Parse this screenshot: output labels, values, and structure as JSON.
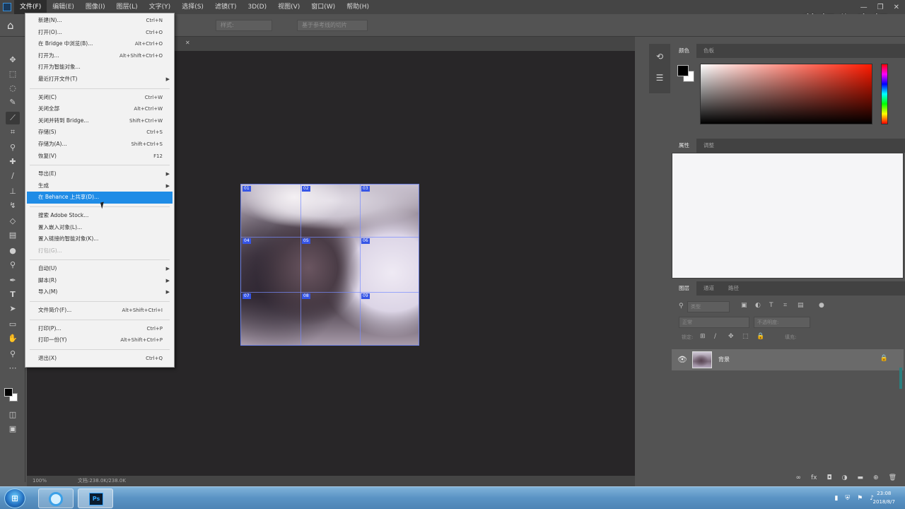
{
  "menubar": {
    "items": [
      "文件(F)",
      "编辑(E)",
      "图像(I)",
      "图层(L)",
      "文字(Y)",
      "选择(S)",
      "滤镜(T)",
      "3D(D)",
      "视图(V)",
      "窗口(W)",
      "帮助(H)"
    ],
    "active_index": 0
  },
  "watermark": "花好你也好",
  "options": {
    "field1": "样式:",
    "field2": "基于参考线的切片"
  },
  "file_menu": {
    "items": [
      {
        "label": "新建(N)...",
        "shortcut": "Ctrl+N"
      },
      {
        "label": "打开(O)...",
        "shortcut": "Ctrl+O"
      },
      {
        "label": "在 Bridge 中浏览(B)...",
        "shortcut": "Alt+Ctrl+O"
      },
      {
        "label": "打开为...",
        "shortcut": "Alt+Shift+Ctrl+O"
      },
      {
        "label": "打开为智能对象...",
        "shortcut": ""
      },
      {
        "label": "最近打开文件(T)",
        "shortcut": "",
        "submenu": true
      },
      {
        "sep": true
      },
      {
        "label": "关闭(C)",
        "shortcut": "Ctrl+W"
      },
      {
        "label": "关闭全部",
        "shortcut": "Alt+Ctrl+W"
      },
      {
        "label": "关闭并转到 Bridge...",
        "shortcut": "Shift+Ctrl+W"
      },
      {
        "label": "存储(S)",
        "shortcut": "Ctrl+S"
      },
      {
        "label": "存储为(A)...",
        "shortcut": "Shift+Ctrl+S"
      },
      {
        "label": "恢复(V)",
        "shortcut": "F12"
      },
      {
        "sep": true
      },
      {
        "label": "导出(E)",
        "shortcut": "",
        "submenu": true
      },
      {
        "label": "生成",
        "shortcut": "",
        "submenu": true
      },
      {
        "label": "在 Behance 上共享(D)...",
        "shortcut": "",
        "highlight": true
      },
      {
        "sep": true
      },
      {
        "label": "搜索 Adobe Stock...",
        "shortcut": ""
      },
      {
        "label": "置入嵌入对象(L)...",
        "shortcut": ""
      },
      {
        "label": "置入链接的智能对象(K)...",
        "shortcut": ""
      },
      {
        "label": "打包(G)...",
        "shortcut": "",
        "disabled": true
      },
      {
        "sep": true
      },
      {
        "label": "自动(U)",
        "shortcut": "",
        "submenu": true
      },
      {
        "label": "脚本(R)",
        "shortcut": "",
        "submenu": true
      },
      {
        "label": "导入(M)",
        "shortcut": "",
        "submenu": true
      },
      {
        "sep": true
      },
      {
        "label": "文件简介(F)...",
        "shortcut": "Alt+Shift+Ctrl+I"
      },
      {
        "sep": true
      },
      {
        "label": "打印(P)...",
        "shortcut": "Ctrl+P"
      },
      {
        "label": "打印一份(Y)",
        "shortcut": "Alt+Shift+Ctrl+P"
      },
      {
        "sep": true
      },
      {
        "label": "退出(X)",
        "shortcut": "Ctrl+Q"
      }
    ]
  },
  "slices": {
    "tags": [
      "01",
      "02",
      "03",
      "04",
      "05",
      "06",
      "07",
      "08",
      "09"
    ]
  },
  "statusbar": {
    "zoom": "100%",
    "doc": "文档:238.0K/238.0K"
  },
  "panels": {
    "color_tabs": [
      "颜色",
      "色板"
    ],
    "props_tabs": [
      "属性",
      "调整"
    ],
    "layers_tabs": [
      "图层",
      "通道",
      "路径"
    ],
    "layers_kind": "类型",
    "layers_blend": "正常",
    "layers_opacity": "不透明度:",
    "layers_lock": "锁定:",
    "layers_fill": "填充:"
  },
  "layer": {
    "name": "背景"
  },
  "taskbar": {
    "ps_label": "Ps",
    "time": "23:08",
    "date": "2018/8/7"
  },
  "colors": {
    "highlight": "#1f8ce6",
    "slice_tag": "#3655e6",
    "foreground": "#000000",
    "background": "#ffffff"
  }
}
